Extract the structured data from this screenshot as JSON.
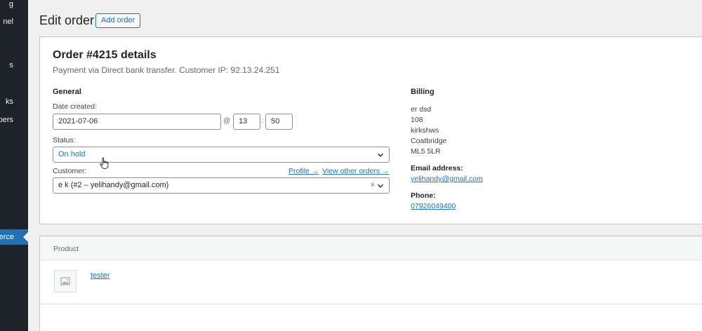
{
  "sidebar": {
    "items": [
      {
        "label": "g",
        "active": false
      },
      {
        "label": "nel",
        "active": false
      },
      {
        "label": "s",
        "active": false
      },
      {
        "label": "ks",
        "active": false
      },
      {
        "label": "pers",
        "active": false
      },
      {
        "label": "erce",
        "active": true
      }
    ]
  },
  "header": {
    "title": "Edit order",
    "add_button": "Add order"
  },
  "order": {
    "heading": "Order #4215 details",
    "meta": "Payment via Direct bank transfer. Customer IP: 92.13.24.251",
    "general": {
      "heading": "General",
      "date_label": "Date created:",
      "date_value": "2021-07-06",
      "at_symbol": "@",
      "hour": "13",
      "colon": ":",
      "minute": "50",
      "status_label": "Status:",
      "status_value": "On hold",
      "customer_label": "Customer:",
      "profile_link": "Profile →",
      "other_orders_link": "View other orders →",
      "customer_value": "e k (#2 – yelihandy@gmail.com)",
      "clear_symbol": "×"
    },
    "billing": {
      "heading": "Billing",
      "address_lines": [
        "er dsd",
        "108",
        "kirkshws",
        "Coatbridge",
        "ML5 5LR"
      ],
      "email_label": "Email address:",
      "email": "yelihandy@gmail.com",
      "phone_label": "Phone:",
      "phone": "07926049400"
    }
  },
  "products": {
    "column_header": "Product",
    "items": [
      {
        "name": "tester"
      }
    ]
  },
  "colors": {
    "accent": "#2271b1",
    "sidebar_bg": "#1d2327",
    "page_bg": "#f0f0f1"
  }
}
